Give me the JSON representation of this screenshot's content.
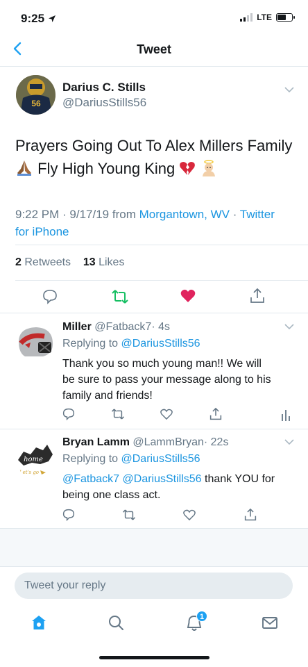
{
  "status_bar": {
    "time": "9:25",
    "network": "LTE"
  },
  "header": {
    "title": "Tweet"
  },
  "main_tweet": {
    "author_name": "Darius C. Stills",
    "author_handle": "@DariusStills56",
    "text_line1": "Prayers Going Out To Alex Millers Family",
    "text_line2": "Fly High Young King",
    "timestamp": "9:22 PM · 9/17/19 from ",
    "location": "Morgantown, WV",
    "separator": " · ",
    "source_line1": "Twitter",
    "source_line2": "for iPhone",
    "retweets_count": "2",
    "retweets_label": "Retweets",
    "likes_count": "13",
    "likes_label": "Likes",
    "jersey_number": "56"
  },
  "replies": [
    {
      "name": "Miller",
      "handle": "@Fatback7",
      "time": "· 4s",
      "replying_to_label": "Replying to",
      "replying_to": "@DariusStills56",
      "body_line1": "Thank you so much young man!! We will",
      "body_line2": "be sure to pass your message along to his",
      "body_line3": "family and friends!"
    },
    {
      "name": "Bryan Lamm",
      "handle": "@LammBryan",
      "time": "· 22s",
      "replying_to_label": "Replying to",
      "replying_to": "@DariusStills56",
      "mention1": "@Fatback7",
      "mention2": "@DariusStills56",
      "body_rest": " thank YOU for",
      "body_line2": "being one class act.",
      "avatar_text": "home",
      "avatar_subtext": "Let's go"
    }
  ],
  "compose": {
    "placeholder": "Tweet your reply"
  },
  "tab_bar": {
    "notifications_badge": "1"
  },
  "colors": {
    "accent": "#1da1f2",
    "retweet_green": "#17bf63",
    "like_red": "#e0245e",
    "muted": "#657786"
  },
  "icons": [
    "back-chevron-icon",
    "chevron-down-icon",
    "reply-icon",
    "retweet-icon",
    "like-icon",
    "share-icon",
    "analytics-icon",
    "home-icon",
    "search-icon",
    "notifications-icon",
    "messages-icon",
    "praying-hands-emoji",
    "broken-heart-emoji",
    "baby-angel-emoji"
  ]
}
